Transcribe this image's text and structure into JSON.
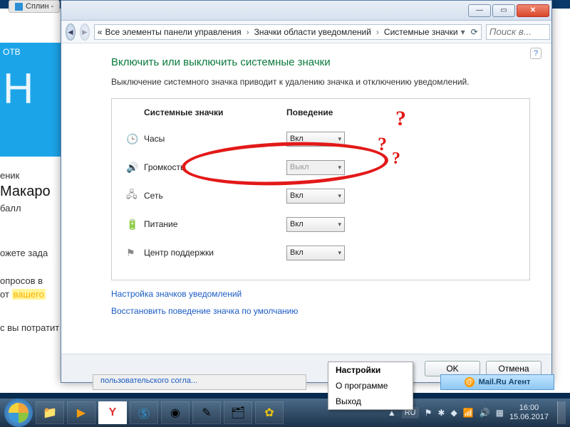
{
  "bg_tab": "Сплин -",
  "left": {
    "otv": "ОТВ",
    "word1": "еник",
    "name": "Макаро",
    "ball": "балл",
    "l1": "ожете зада",
    "l2": "опросов в",
    "l3_a": "от ",
    "l3_b": "вашего",
    "l4": "с вы потратит"
  },
  "breadcrumbs": {
    "b0": "«",
    "b1": "Все элементы панели управления",
    "b2": "Значки области уведомлений",
    "b3": "Системные значки"
  },
  "search_placeholder": "Поиск в...",
  "page": {
    "title": "Включить или выключить системные значки",
    "subtitle": "Выключение системного значка приводит к удалению значка и отключению уведомлений.",
    "col1": "Системные значки",
    "col2": "Поведение",
    "rows": {
      "clock": {
        "label": "Часы",
        "value": "Вкл",
        "disabled": false
      },
      "volume": {
        "label": "Громкость",
        "value": "Выкл",
        "disabled": true
      },
      "network": {
        "label": "Сеть",
        "value": "Вкл",
        "disabled": false
      },
      "power": {
        "label": "Питание",
        "value": "Вкл",
        "disabled": false
      },
      "action": {
        "label": "Центр поддержки",
        "value": "Вкл",
        "disabled": false
      }
    },
    "link1": "Настройка значков уведомлений",
    "link2": "Восстановить поведение значка по умолчанию",
    "ok": "OK",
    "cancel": "Отмена"
  },
  "context_menu": {
    "i1": "Настройки",
    "i2": "О программе",
    "i3": "Выход"
  },
  "mailru": "Mail.Ru Агент",
  "chat_hint": "пользовательского согла...",
  "tray": {
    "lang": "RU",
    "time": "16:00",
    "date": "15.06.2017"
  },
  "icons": {
    "back": "◄",
    "fwd": "►",
    "up": "▲",
    "drop": "▾",
    "sep": "›",
    "clock": "🕒",
    "vol": "🔊",
    "net": "🖧",
    "pwr": "🔋",
    "flag": "⚑",
    "min": "—",
    "max": "▭",
    "close": "✕",
    "help": "?",
    "refresh": "⟳",
    "arrowup": "▲"
  }
}
